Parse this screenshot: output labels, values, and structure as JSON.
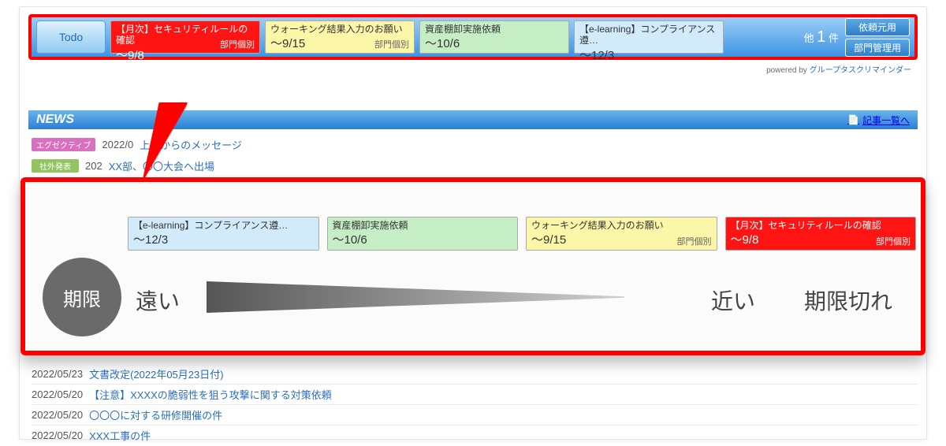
{
  "todo": {
    "label": "Todo",
    "cards": [
      {
        "title": "【月次】セキュリティルールの確認",
        "deadline": "～9/8",
        "tag": "部門個別",
        "cls": "c-red"
      },
      {
        "title": "ウォーキング結果入力のお願い",
        "deadline": "～9/15",
        "tag": "部門個別",
        "cls": "c-yellow"
      },
      {
        "title": "資産棚卸実施依頼",
        "deadline": "～10/6",
        "tag": "",
        "cls": "c-green"
      },
      {
        "title": "【e-learning】コンプライアンス遵…",
        "deadline": "～12/3",
        "tag": "",
        "cls": "c-blue"
      }
    ],
    "more_prefix": "他 ",
    "more_count": "1",
    "more_suffix": " 件",
    "buttons": {
      "a": "依頼元用",
      "b": "部門管理用"
    },
    "powered_prefix": "powered by ",
    "powered_link": "グループタスクリマインダー"
  },
  "news": {
    "header": "NEWS",
    "more": "記事一覧へ",
    "top": [
      {
        "badge": "エグゼクティブ",
        "badge_cls": "b-pink",
        "date": "2022/0",
        "title": "上長からのメッセージ"
      },
      {
        "badge": "社外発表",
        "badge_cls": "b-grn",
        "date": "202",
        "title": "XX部、〇〇大会へ出場"
      }
    ],
    "list": [
      {
        "date": "2022/05/23",
        "title": "文書改定(2022年05月23日付)"
      },
      {
        "date": "2022/05/20",
        "title": "【注意】XXXXの脆弱性を狙う攻撃に関する対策依頼"
      },
      {
        "date": "2022/05/20",
        "title": "〇〇〇に対する研修開催の件"
      },
      {
        "date": "2022/05/20",
        "title": "XXX工事の件"
      }
    ]
  },
  "mag": {
    "cards": [
      {
        "title": "【e-learning】コンプライアンス遵…",
        "deadline": "～12/3",
        "tag": "",
        "cls": "c-blue"
      },
      {
        "title": "資産棚卸実施依頼",
        "deadline": "～10/6",
        "tag": "",
        "cls": "c-green"
      },
      {
        "title": "ウォーキング結果入力のお願い",
        "deadline": "～9/15",
        "tag": "部門個別",
        "cls": "c-yellow"
      },
      {
        "title": "【月次】セキュリティルールの確認",
        "deadline": "～9/8",
        "tag": "部門個別",
        "cls": "c-red"
      }
    ],
    "circle": "期限",
    "far": "遠い",
    "near": "近い",
    "over": "期限切れ"
  }
}
